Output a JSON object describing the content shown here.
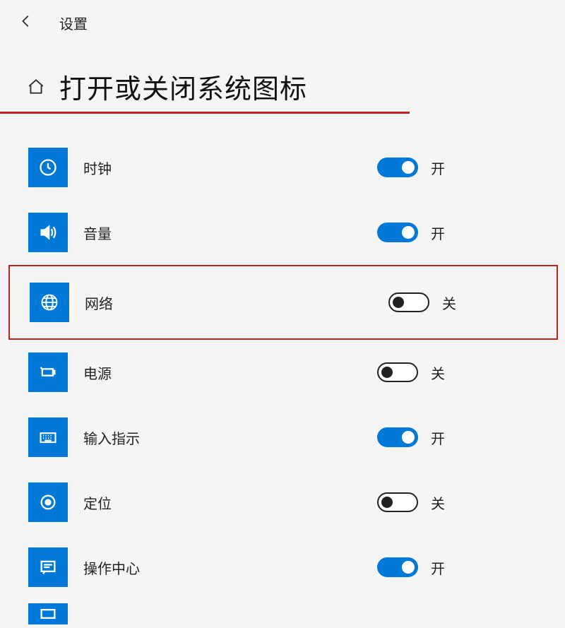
{
  "header": {
    "title": "设置"
  },
  "page": {
    "title": "打开或关闭系统图标"
  },
  "toggle_labels": {
    "on": "开",
    "off": "关"
  },
  "items": [
    {
      "id": "clock",
      "label": "时钟",
      "state": "on",
      "highlighted": false
    },
    {
      "id": "volume",
      "label": "音量",
      "state": "on",
      "highlighted": false
    },
    {
      "id": "network",
      "label": "网络",
      "state": "off",
      "highlighted": true
    },
    {
      "id": "power",
      "label": "电源",
      "state": "off",
      "highlighted": false
    },
    {
      "id": "input",
      "label": "输入指示",
      "state": "on",
      "highlighted": false
    },
    {
      "id": "location",
      "label": "定位",
      "state": "off",
      "highlighted": false
    },
    {
      "id": "actioncenter",
      "label": "操作中心",
      "state": "on",
      "highlighted": false
    }
  ]
}
